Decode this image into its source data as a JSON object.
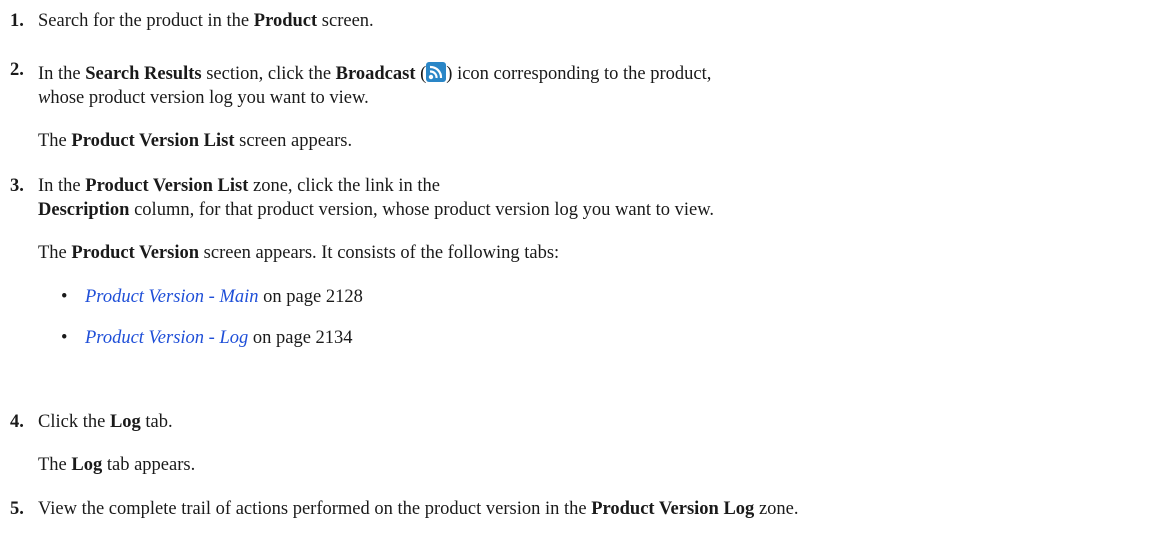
{
  "steps": [
    {
      "number": "1.",
      "p1": "Search for the product in the ",
      "p1_bold": "Product",
      "p1_end": " screen."
    },
    {
      "number": "2.",
      "p1": "In the ",
      "p1_bold1": "Search Results",
      "p1_mid": " section, click the ",
      "p1_bold2": "Broadcast",
      "p1_open": " (",
      "icon": "broadcast-icon",
      "p1_close": ") icon corresponding to the product,",
      "line2_italic": "w",
      "line2": "hose product version log you want to view.",
      "result_bold": "Product Version List",
      "result": " screen appears.",
      "result_pre": "The "
    },
    {
      "number": "3.",
      "p1": "In the ",
      "p1_bold": "Product Version List",
      "p1_end": " zone, click the link in the",
      "line2_bold": "Description",
      "line2": " column, for that product version, whose product version log you want to view.",
      "result_pre": "The ",
      "result_bold": "Product Version",
      "result": " screen appears. It consists of the following tabs:",
      "bullets": [
        {
          "bullet": "•",
          "link": "Product Version - Main",
          "page": " on page 2128"
        },
        {
          "bullet": "•",
          "link": "Product Version - Log",
          "page": " on page 2134"
        }
      ]
    },
    {
      "number": "4.",
      "p1": "Click the ",
      "p1_bold": "Log",
      "p1_end": " tab.",
      "result_pre": "The ",
      "result_bold": "Log",
      "result": " tab appears."
    },
    {
      "number": "5.",
      "p1": "View the complete trail of actions performed on the product version in the ",
      "p1_bold": "Product Version Log",
      "p1_end": " zone."
    }
  ],
  "icon_color": "#2a86c7",
  "link_color": "#1f4fd8"
}
